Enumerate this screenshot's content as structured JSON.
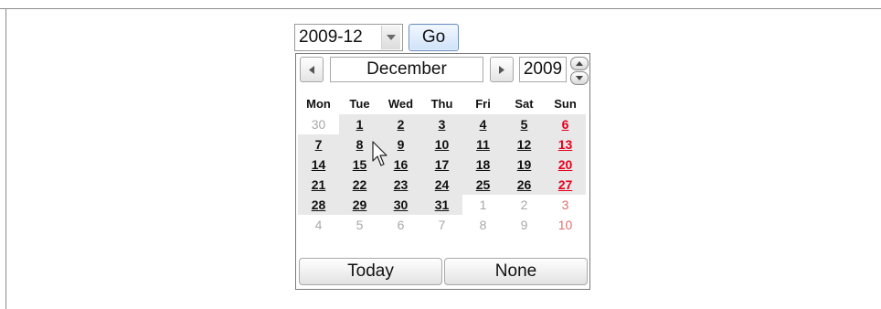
{
  "picker": {
    "month_value": "2009-12",
    "go_label": "Go"
  },
  "calendar": {
    "month_label": "December",
    "year_value": "2009",
    "weekdays": [
      "Mon",
      "Tue",
      "Wed",
      "Thu",
      "Fri",
      "Sat",
      "Sun"
    ],
    "weeks": [
      [
        "30",
        "1",
        "2",
        "3",
        "4",
        "5",
        "6"
      ],
      [
        "7",
        "8",
        "9",
        "10",
        "11",
        "12",
        "13"
      ],
      [
        "14",
        "15",
        "16",
        "17",
        "18",
        "19",
        "20"
      ],
      [
        "21",
        "22",
        "23",
        "24",
        "25",
        "26",
        "27"
      ],
      [
        "28",
        "29",
        "30",
        "31",
        "1",
        "2",
        "3"
      ],
      [
        "4",
        "5",
        "6",
        "7",
        "8",
        "9",
        "10"
      ]
    ],
    "today_label": "Today",
    "none_label": "None"
  },
  "icons": {
    "dropdown": "chevron-down-icon",
    "prev": "triangle-left-icon",
    "next": "triangle-right-icon",
    "spin_up": "triangle-up-icon",
    "spin_down": "triangle-down-icon",
    "cursor": "mouse-pointer-icon"
  },
  "colors": {
    "sunday": "#e8001c",
    "other_month": "#a8a8a8",
    "current_month_bg": "#e8e8e8"
  }
}
